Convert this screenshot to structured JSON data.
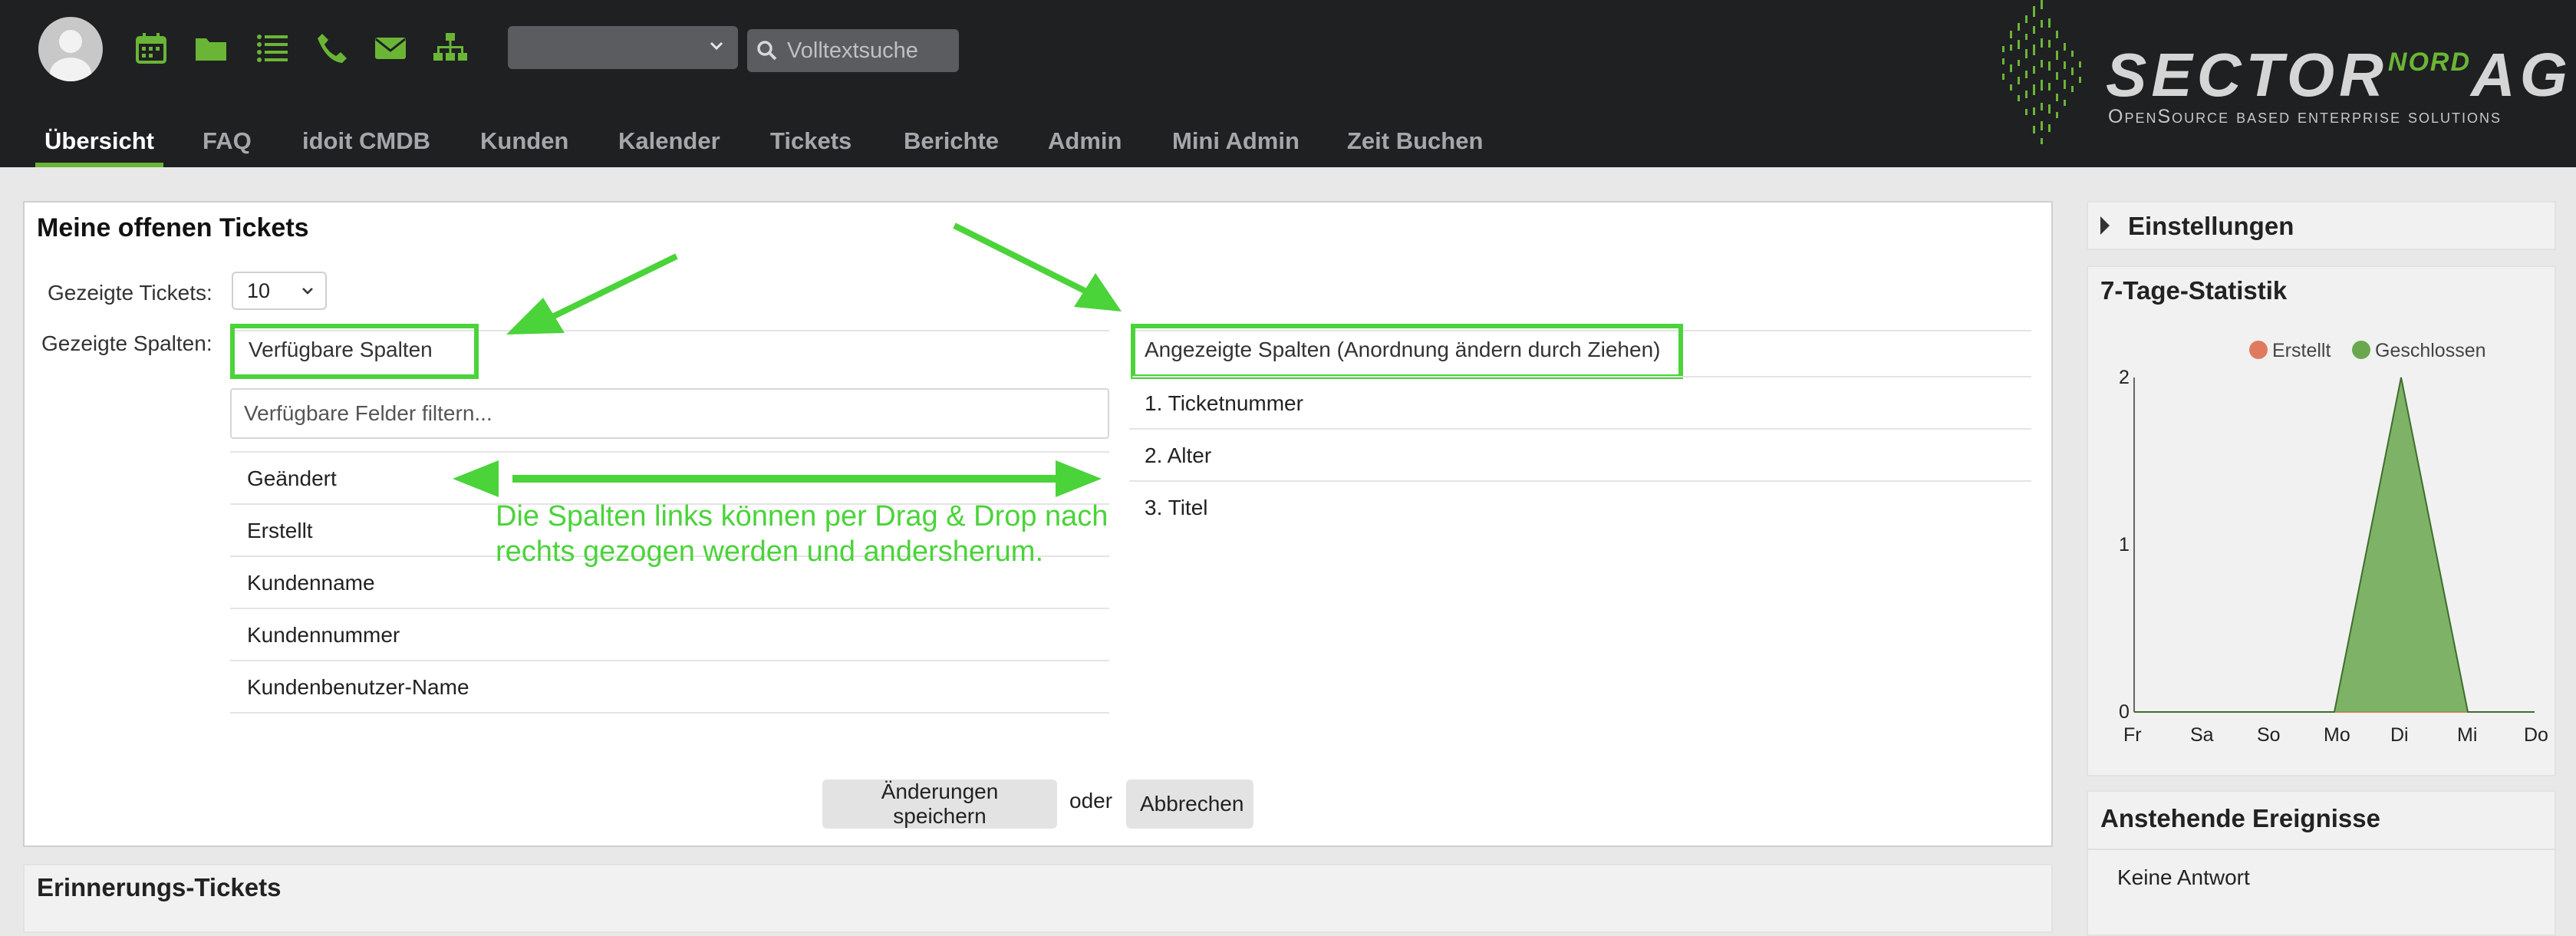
{
  "header": {
    "search_placeholder": "Volltextsuche",
    "logo": {
      "main": "SECTOR",
      "superscript": "NORD",
      "suffix": "AG",
      "tagline": "OpenSource based enterprise solutions"
    },
    "icons": [
      "user-avatar",
      "calendar-icon",
      "folder-icon",
      "list-icon",
      "phone-icon",
      "mail-icon",
      "sitemap-icon"
    ],
    "accent_color": "#6ab536"
  },
  "nav": {
    "items": [
      {
        "label": "Übersicht",
        "active": true
      },
      {
        "label": "FAQ"
      },
      {
        "label": "idoit CMDB"
      },
      {
        "label": "Kunden"
      },
      {
        "label": "Kalender"
      },
      {
        "label": "Tickets"
      },
      {
        "label": "Berichte"
      },
      {
        "label": "Admin"
      },
      {
        "label": "Mini Admin"
      },
      {
        "label": "Zeit Buchen"
      }
    ]
  },
  "main": {
    "title": "Meine offenen Tickets",
    "shown_tickets_label": "Gezeigte Tickets:",
    "shown_tickets_value": "10",
    "shown_columns_label": "Gezeigte Spalten:",
    "available": {
      "header": "Verfügbare Spalten",
      "filter_placeholder": "Verfügbare Felder filtern...",
      "items": [
        "Geändert",
        "Erstellt",
        "Kundenname",
        "Kundennummer",
        "Kundenbenutzer-Name"
      ]
    },
    "displayed": {
      "header": "Angezeigte Spalten (Anordnung ändern durch Ziehen)",
      "items": [
        "1. Ticketnummer",
        "2. Alter",
        "3. Titel"
      ]
    },
    "annotation": "Die Spalten links können per Drag & Drop nach rechts gezogen werden und andersherum.",
    "annotation_color": "#4bd33a",
    "save_label": "Änderungen speichern",
    "or_label": "oder",
    "cancel_label": "Abbrechen"
  },
  "sidebar": {
    "settings_title": "Einstellungen",
    "stats_title": "7-Tage-Statistik",
    "events_title": "Anstehende Ereignisse",
    "events_empty": "Keine Antwort"
  },
  "bottom": {
    "reminder_title": "Erinnerungs-Tickets"
  },
  "chart_data": {
    "type": "area",
    "categories": [
      "Fr",
      "Sa",
      "So",
      "Mo",
      "Di",
      "Mi",
      "Do"
    ],
    "series": [
      {
        "name": "Erstellt",
        "values": [
          0,
          0,
          0,
          0,
          0,
          0,
          0
        ],
        "color": "#e07a5f"
      },
      {
        "name": "Geschlossen",
        "values": [
          0,
          0,
          0,
          0,
          2,
          0,
          0
        ],
        "color": "#6aa84f"
      }
    ],
    "ylim": [
      0,
      2
    ],
    "yticks": [
      0,
      1,
      2
    ],
    "legend": "top"
  }
}
